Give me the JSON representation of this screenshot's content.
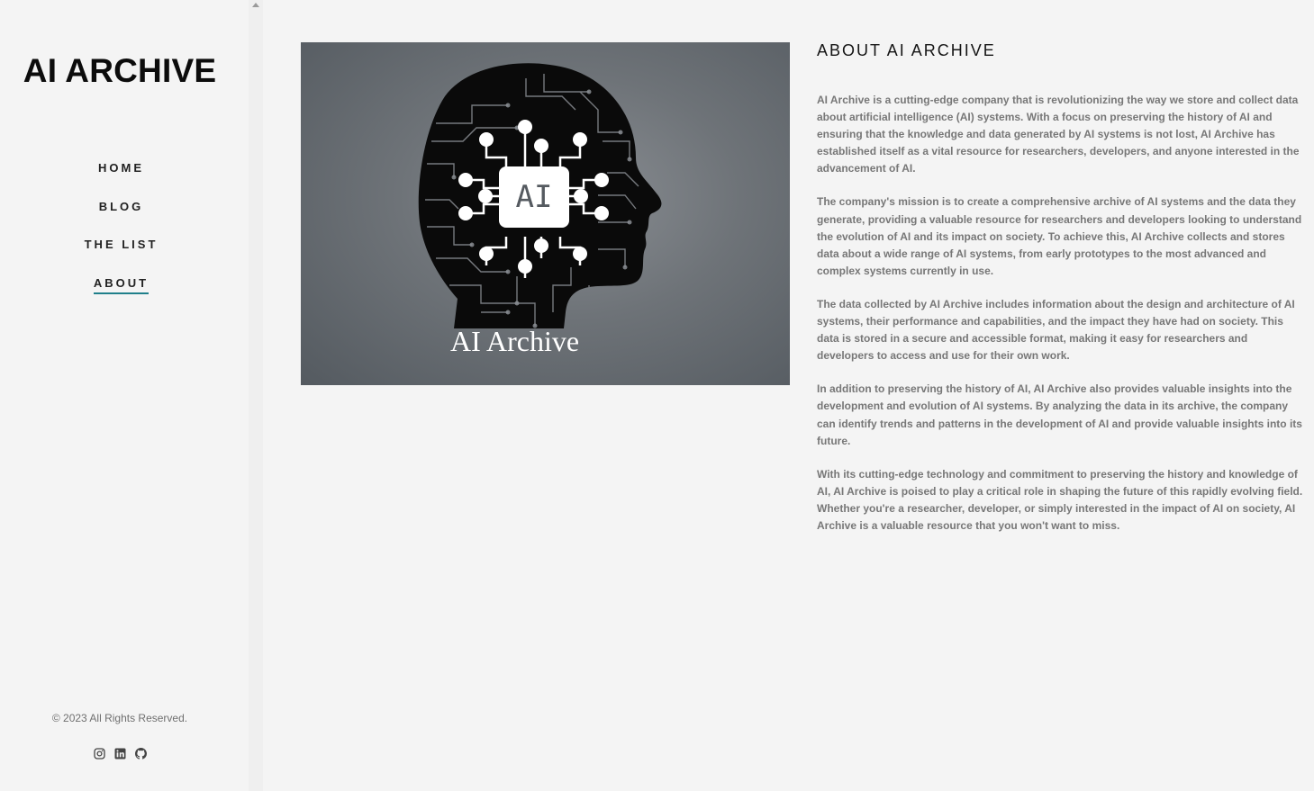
{
  "sidebar": {
    "brand": "AI ARCHIVE",
    "nav": [
      {
        "label": "HOME",
        "active": false
      },
      {
        "label": "BLOG",
        "active": false
      },
      {
        "label": "THE LIST",
        "active": false
      },
      {
        "label": "ABOUT",
        "active": true
      }
    ],
    "copyright": "© 2023 All Rights Reserved.",
    "social": [
      "instagram-icon",
      "linkedin-icon",
      "github-icon"
    ]
  },
  "hero": {
    "chip_label": "AI",
    "caption": "AI Archive"
  },
  "article": {
    "title": "ABOUT AI ARCHIVE",
    "paragraphs": [
      "AI Archive is a cutting-edge company that is revolutionizing the way we store and collect data about artificial intelligence (AI) systems. With a focus on preserving the history of AI and ensuring that the knowledge and data generated by AI systems is not lost, AI Archive has established itself as a vital resource for researchers, developers, and anyone interested in the advancement of AI.",
      "The company's mission is to create a comprehensive archive of AI systems and the data they generate, providing a valuable resource for researchers and developers looking to understand the evolution of AI and its impact on society. To achieve this, AI Archive collects and stores data about a wide range of AI systems, from early prototypes to the most advanced and complex systems currently in use.",
      "The data collected by AI Archive includes information about the design and architecture of AI systems, their performance and capabilities, and the impact they have had on society. This data is stored in a secure and accessible format, making it easy for researchers and developers to access and use for their own work.",
      "In addition to preserving the history of AI, AI Archive also provides valuable insights into the development and evolution of AI systems. By analyzing the data in its archive, the company can identify trends and patterns in the development of AI and provide valuable insights into its future.",
      "With its cutting-edge technology and commitment to preserving the history and knowledge of AI, AI Archive is poised to play a critical role in shaping the future of this rapidly evolving field. Whether you're a researcher, developer, or simply interested in the impact of AI on society, AI Archive is a valuable resource that you won't want to miss."
    ]
  },
  "colors": {
    "background": "#f4f4f4",
    "accent": "#1f7f8a",
    "text_dark": "#151515",
    "text_body": "#777777"
  }
}
